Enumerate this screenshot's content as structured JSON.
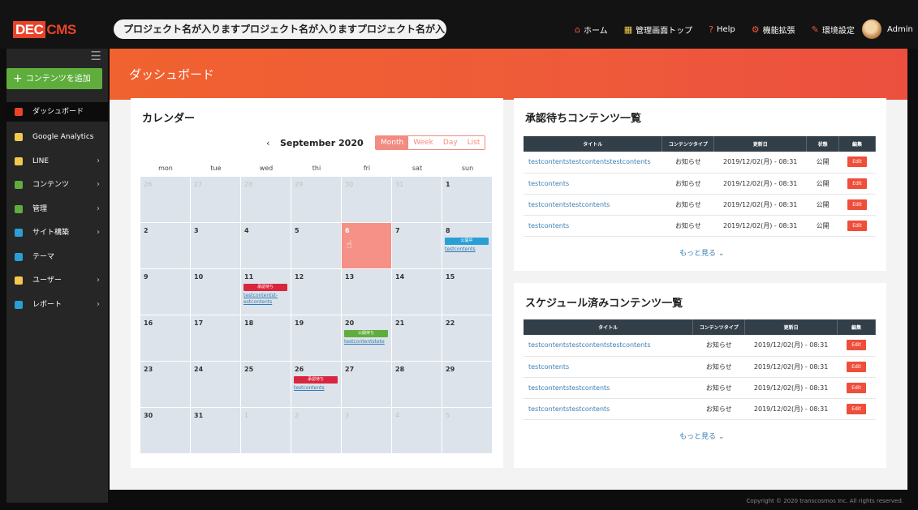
{
  "app": {
    "logo_dec": "DEC",
    "logo_cms": "CMS",
    "project_name": "プロジェクト名が入りますプロジェクト名が入りますプロジェクト名が入ります"
  },
  "topnav": [
    {
      "label": "ホーム",
      "icon": "home-icon",
      "glyph": "⌂",
      "color": "#ee5a3a"
    },
    {
      "label": "管理画面トップ",
      "icon": "grid-icon",
      "glyph": "▦",
      "color": "#f2c94c"
    },
    {
      "label": "Help",
      "icon": "help-icon",
      "glyph": "?",
      "color": "#ee5a3a"
    },
    {
      "label": "機能拡張",
      "icon": "extension-icon",
      "glyph": "⚙",
      "color": "#ee5a3a"
    },
    {
      "label": "環境設定",
      "icon": "wrench-icon",
      "glyph": "✎",
      "color": "#ee5a3a"
    }
  ],
  "user": {
    "name": "Admin"
  },
  "sidebar": {
    "add_label": "コンテンツを追加",
    "items": [
      {
        "label": "ダッシュボード",
        "icon": "dashboard-icon",
        "color": "#e9442a",
        "chevron": false,
        "active": true
      },
      {
        "label": "Google Analytics",
        "icon": "analytics-icon",
        "color": "#f2c94c",
        "chevron": false,
        "active": false
      },
      {
        "label": "LINE",
        "icon": "line-icon",
        "color": "#f2c94c",
        "chevron": true,
        "active": false
      },
      {
        "label": "コンテンツ",
        "icon": "content-icon",
        "color": "#5fae3d",
        "chevron": true,
        "active": false
      },
      {
        "label": "管理",
        "icon": "manage-icon",
        "color": "#5fae3d",
        "chevron": true,
        "active": false
      },
      {
        "label": "サイト構築",
        "icon": "sitemap-icon",
        "color": "#2a9fd6",
        "chevron": true,
        "active": false
      },
      {
        "label": "テーマ",
        "icon": "theme-icon",
        "color": "#2a9fd6",
        "chevron": false,
        "active": false
      },
      {
        "label": "ユーザー",
        "icon": "user-icon",
        "color": "#f2c94c",
        "chevron": true,
        "active": false
      },
      {
        "label": "レポート",
        "icon": "report-icon",
        "color": "#2a9fd6",
        "chevron": true,
        "active": false
      }
    ]
  },
  "page": {
    "title": "ダッシュボード",
    "copyright": "Copyright © 2020 transcosmos Inc. All rights reserved."
  },
  "calendar": {
    "title": "カレンダー",
    "month": "September 2020",
    "views": [
      "Month",
      "Week",
      "Day",
      "List"
    ],
    "active_view": "Month",
    "dow": [
      "mon",
      "tue",
      "wed",
      "thi",
      "fri",
      "sat",
      "sun"
    ],
    "weeks": [
      [
        "26",
        "27",
        "28",
        "29",
        "30",
        "31",
        "1"
      ],
      [
        "2",
        "3",
        "4",
        "5",
        "6",
        "7",
        "8"
      ],
      [
        "9",
        "10",
        "11",
        "12",
        "13",
        "14",
        "15"
      ],
      [
        "16",
        "17",
        "18",
        "19",
        "20",
        "21",
        "22"
      ],
      [
        "23",
        "24",
        "25",
        "26",
        "27",
        "28",
        "29"
      ],
      [
        "30",
        "31",
        "1",
        "2",
        "3",
        "4",
        "5"
      ]
    ],
    "dim_first_week_until": 6,
    "dim_last_week_from": 2,
    "today": {
      "week": 1,
      "day": 4
    },
    "events": [
      {
        "week": 1,
        "day": 6,
        "label": "公開中",
        "color": "blue",
        "link": "testcontents"
      },
      {
        "week": 2,
        "day": 2,
        "label": "承認待ち",
        "color": "red",
        "link": "testcontentst-estcontents"
      },
      {
        "week": 3,
        "day": 4,
        "label": "公開待ち",
        "color": "green",
        "link": "testcontentstete"
      },
      {
        "week": 4,
        "day": 3,
        "label": "承認待ち",
        "color": "red",
        "link": "testcontents"
      }
    ]
  },
  "approval": {
    "title": "承認待ちコンテンツ一覧",
    "headers": [
      "タイトル",
      "コンテンツタイプ",
      "更新日",
      "状態",
      "編集"
    ],
    "rows": [
      [
        "testcontentstestcontentstestcontents",
        "お知らせ",
        "2019/12/02(月) - 08:31",
        "公開",
        "Edit"
      ],
      [
        "testcontents",
        "お知らせ",
        "2019/12/02(月) - 08:31",
        "公開",
        "Edit"
      ],
      [
        "testcontentstestcontents",
        "お知らせ",
        "2019/12/02(月) - 08:31",
        "公開",
        "Edit"
      ],
      [
        "testcontents",
        "お知らせ",
        "2019/12/02(月) - 08:31",
        "公開",
        "Edit"
      ]
    ],
    "more": "もっと見る"
  },
  "scheduled": {
    "title": "スケジュール済みコンテンツ一覧",
    "headers": [
      "タイトル",
      "コンテンツタイプ",
      "更新日",
      "編集"
    ],
    "rows": [
      [
        "testcontentstestcontentstestcontents",
        "お知らせ",
        "2019/12/02(月) - 08:31",
        "Edit"
      ],
      [
        "testcontents",
        "お知らせ",
        "2019/12/02(月) - 08:31",
        "Edit"
      ],
      [
        "testcontentstestcontents",
        "お知らせ",
        "2019/12/02(月) - 08:31",
        "Edit"
      ],
      [
        "testcontentstestcontents",
        "お知らせ",
        "2019/12/02(月) - 08:31",
        "Edit"
      ]
    ],
    "more": "もっと見る"
  }
}
